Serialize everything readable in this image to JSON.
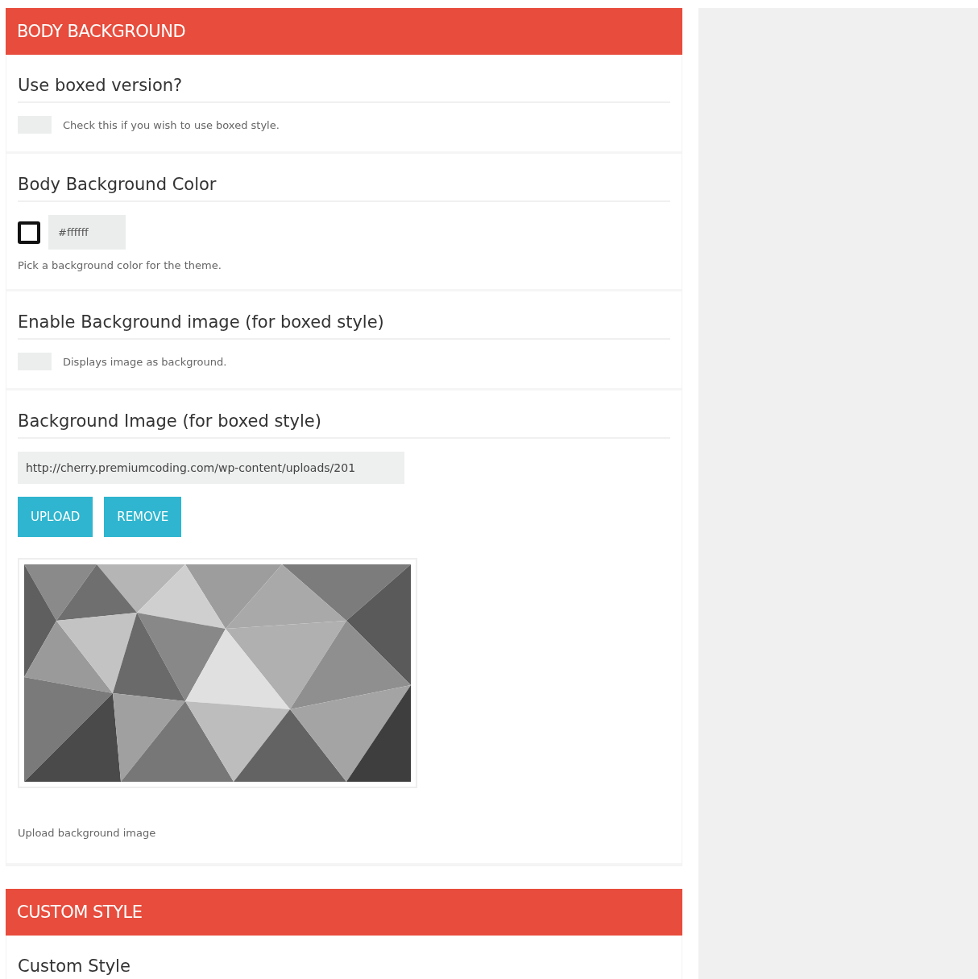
{
  "panels": [
    {
      "title": "BODY BACKGROUND",
      "sections": [
        {
          "kind": "checkbox",
          "title": "Use boxed version?",
          "checked": false,
          "description": "Check this if you wish to use boxed style."
        },
        {
          "kind": "color",
          "title": "Body Background Color",
          "value": "#ffffff",
          "description": "Pick a background color for the theme."
        },
        {
          "kind": "checkbox",
          "title": "Enable Background image (for boxed style)",
          "checked": false,
          "description": "Displays image as background."
        },
        {
          "kind": "image",
          "title": "Background Image (for boxed style)",
          "value": "http://cherry.premiumcoding.com/wp-content/uploads/201",
          "buttons": [
            "UPLOAD",
            "REMOVE"
          ],
          "description": "Upload background image"
        }
      ]
    },
    {
      "title": "CUSTOM STYLE",
      "sections": [
        {
          "kind": "plain",
          "title": "Custom Style"
        }
      ]
    }
  ]
}
